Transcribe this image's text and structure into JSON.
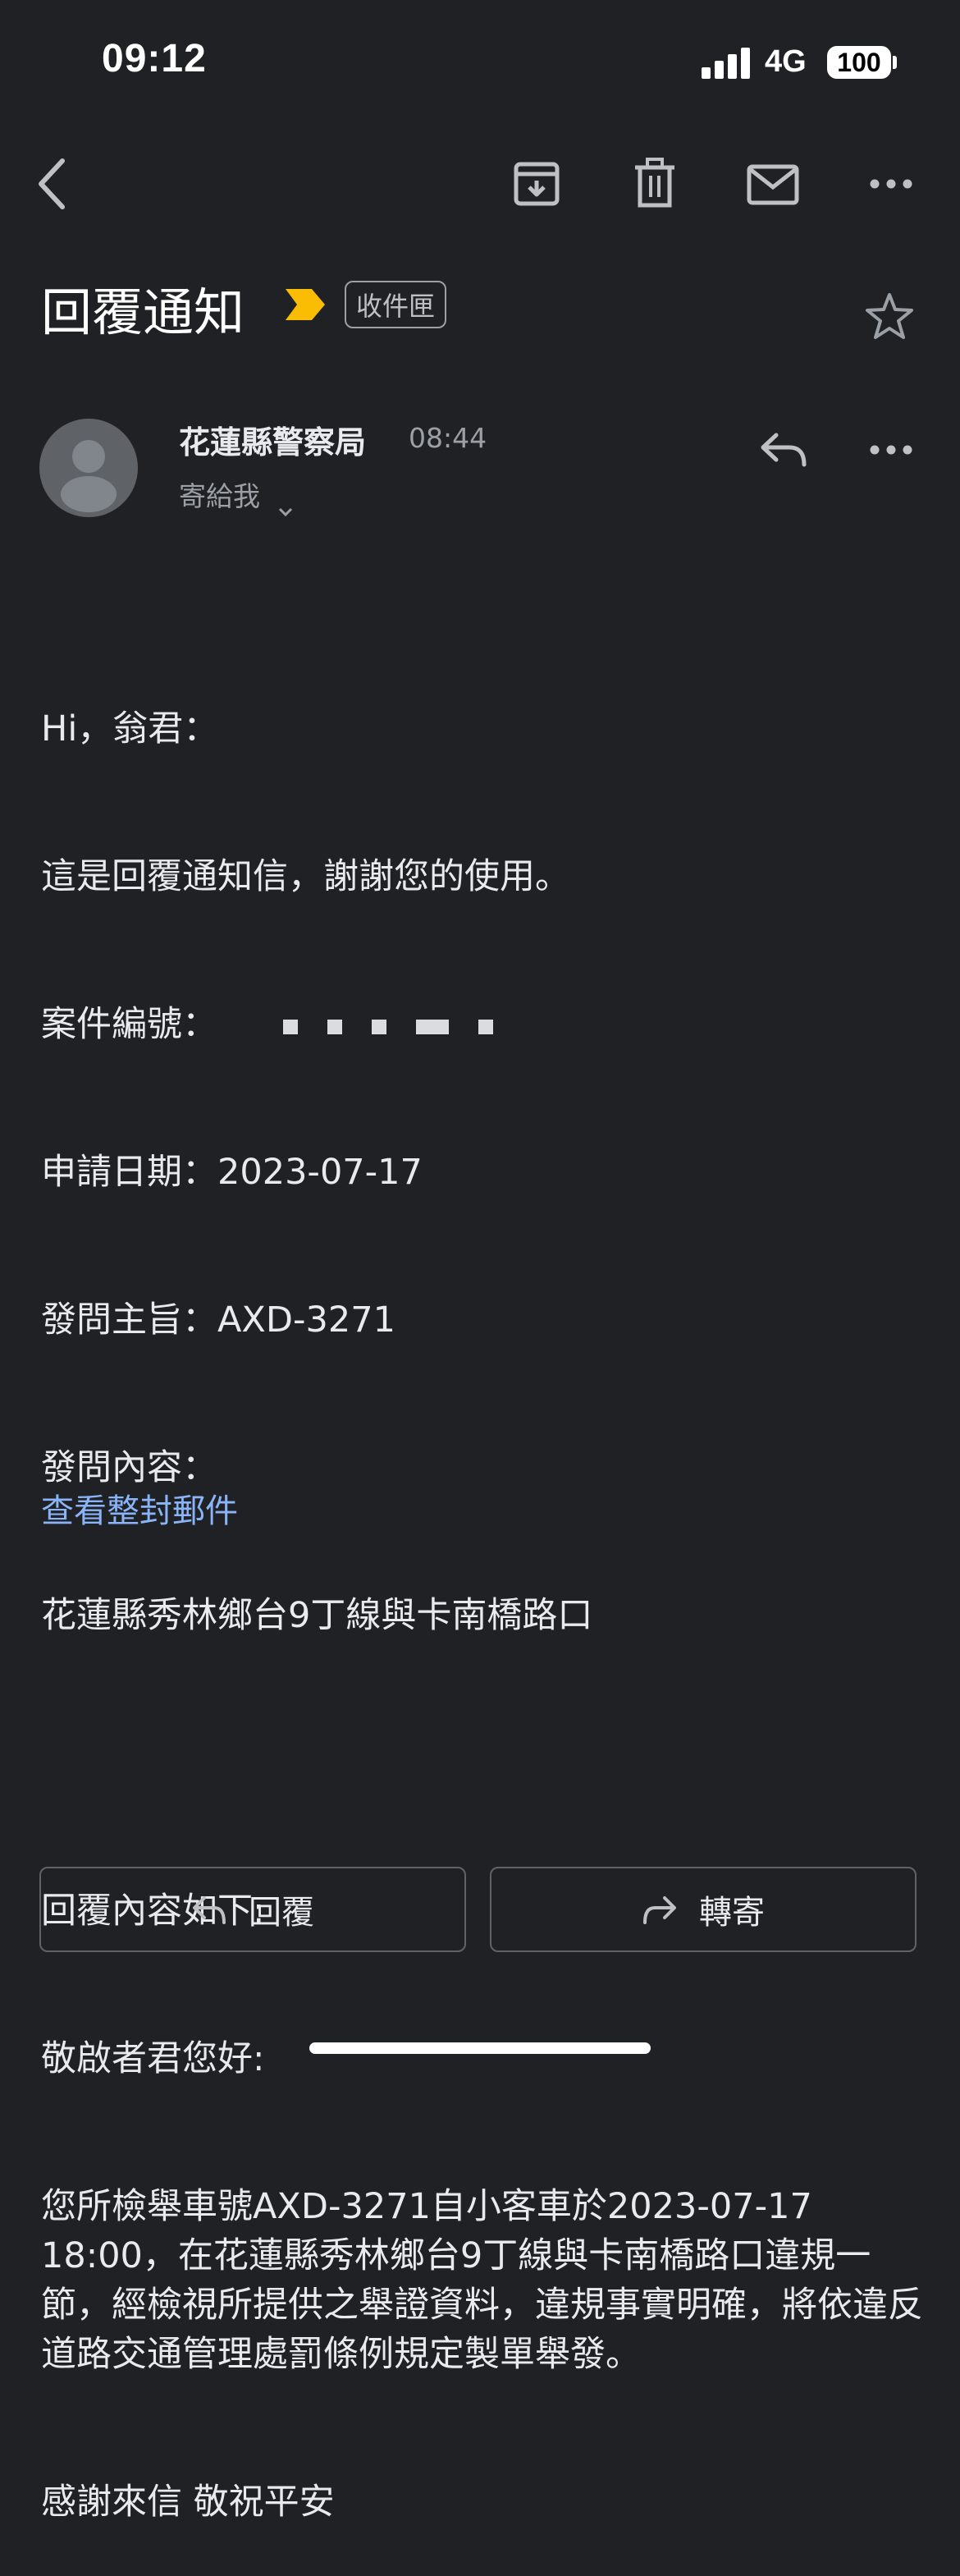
{
  "status_bar": {
    "time": "09:12",
    "network": "4G",
    "battery": "100"
  },
  "toolbar": {
    "icons": [
      "back-icon",
      "archive-icon",
      "delete-icon",
      "mail-icon",
      "more-icon"
    ]
  },
  "email": {
    "subject": "回覆通知",
    "label": "收件匣",
    "sender_name": "花蓮縣警察局",
    "time": "08:44",
    "recipient": "寄給我",
    "body": {
      "greeting": "Hi，翁君：",
      "intro": "這是回覆通知信，謝謝您的使用。",
      "case_label": "案件編號：",
      "date_line": "申請日期：2023-07-17",
      "subject_line": "發問主旨：AXD-3271",
      "content_label": "發問內容：",
      "content": "花蓮縣秀林鄉台9丁線與卡南橋路口",
      "reply_header": "回覆內容如下:",
      "salutation": "敬啟者君您好:",
      "reply_text": "您所檢舉車號AXD-3271自小客車於2023-07-17 18:00，在花蓮縣秀林鄉台9丁線與卡南橋路口違規一節，經檢視所提供之舉證資料，違規事實明確，將依違反道路交通管理處罰條例規定製單舉發。",
      "closing": "感謝來信 敬祝平安"
    },
    "view_full": "查看整封郵件"
  },
  "actions": {
    "reply": "回覆",
    "forward": "轉寄"
  },
  "colors": {
    "background": "#202124",
    "text": "#e8eaed",
    "secondary": "#9aa0a6",
    "link": "#8ab4f8",
    "important": "#fbbc04"
  }
}
